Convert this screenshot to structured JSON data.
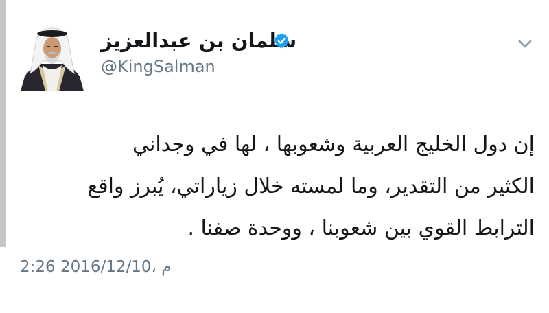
{
  "tweet": {
    "author": {
      "name": "سلمان بن عبدالعزيز",
      "handle": "@KingSalman",
      "verified": true,
      "avatar_icon": "portrait-avatar"
    },
    "text_lines": [
      "إن دول الخليج العربية وشعوبها ، لها في وجداني",
      "الكثير من التقدير، وما لمسته خلال زياراتي، يُبرز واقع",
      "الترابط القوي بين شعوبنا ، ووحدة صفنا ."
    ],
    "timestamp": "2:26 م ،2016/12/10",
    "menu_icon": "chevron-down-icon"
  },
  "colors": {
    "text": "#14171a",
    "secondary": "#657786",
    "verified_blue": "#1da1f2",
    "left_bar": "#c4c6c8",
    "divider": "#e1e8ed"
  }
}
